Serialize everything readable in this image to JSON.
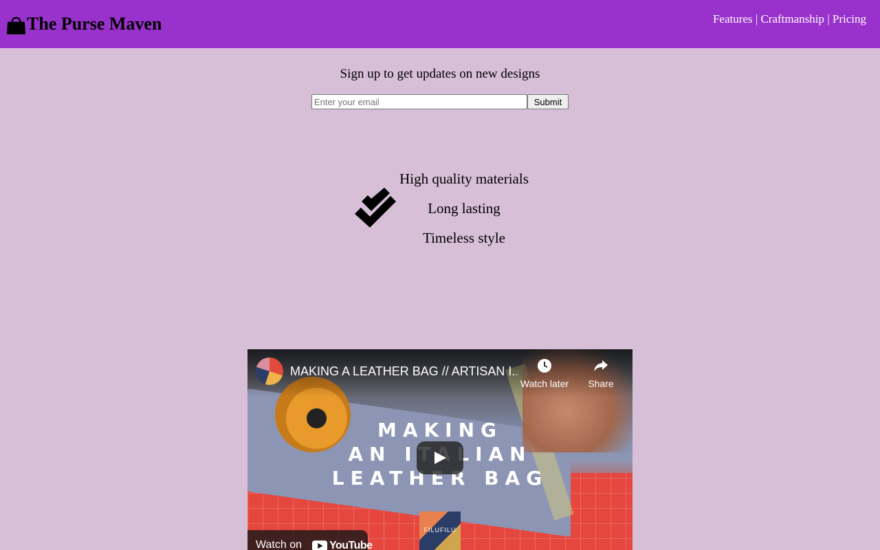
{
  "header": {
    "brand": "The Purse Maven",
    "nav": [
      {
        "label": "Features"
      },
      {
        "label": "Craftmanship"
      },
      {
        "label": "Pricing"
      }
    ],
    "separator": " | "
  },
  "signup": {
    "text": "Sign up to get updates on new designs",
    "email_placeholder": "Enter your email",
    "submit_label": "Submit"
  },
  "features": [
    "High quality materials",
    "Long lasting",
    "Timeless style"
  ],
  "video": {
    "title": "MAKING A LEATHER BAG // ARTISAN I...",
    "watch_later": "Watch later",
    "share": "Share",
    "heading_lines": [
      "MAKING",
      "AN ITALIAN",
      "LEATHER BAG"
    ],
    "thumbnail_brand": "FILUFILU",
    "watch_on": "Watch on",
    "youtube": "YouTube"
  },
  "colors": {
    "header_bg": "#9932cc",
    "page_bg": "#d8bfd8",
    "nav_text": "#ffffff"
  },
  "icons": {
    "logo": "handbag-icon",
    "features": "double-check-icon"
  }
}
